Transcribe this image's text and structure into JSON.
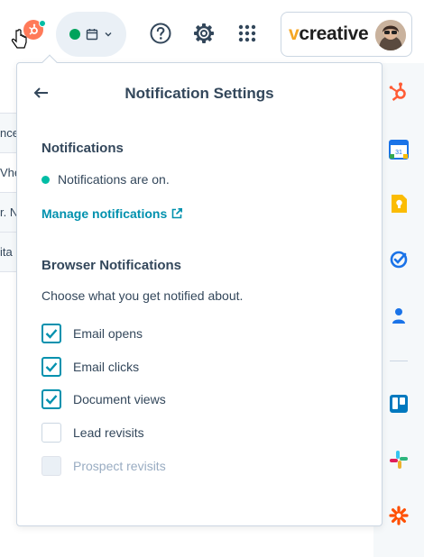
{
  "left_partial_rows": [
    "nce",
    "Vhe",
    "r. N",
    "ita"
  ],
  "header": {
    "brand_prefix": "v",
    "brand_suffix": "creative"
  },
  "popover": {
    "title": "Notification Settings",
    "notifications_heading": "Notifications",
    "status_text": "Notifications are on.",
    "manage_link": "Manage notifications",
    "browser_heading": "Browser Notifications",
    "choose_text": "Choose what you get notified about.",
    "options": [
      {
        "label": "Email opens",
        "checked": true
      },
      {
        "label": "Email clicks",
        "checked": true
      },
      {
        "label": "Document views",
        "checked": true
      },
      {
        "label": "Lead revisits",
        "checked": false
      },
      {
        "label": "Prospect revisits",
        "checked": false,
        "disabled": true
      }
    ]
  },
  "colors": {
    "accent": "#0091ae",
    "teal_status": "#00bda5",
    "hubspot_orange": "#ff7a59",
    "status_green": "#00a35c"
  },
  "icons": {
    "rail": [
      "hubspot-sprocket-icon",
      "google-calendar-icon",
      "google-keep-icon",
      "checkmark-app-icon",
      "contacts-icon",
      "trello-icon",
      "slack-icon",
      "zapier-icon"
    ]
  }
}
